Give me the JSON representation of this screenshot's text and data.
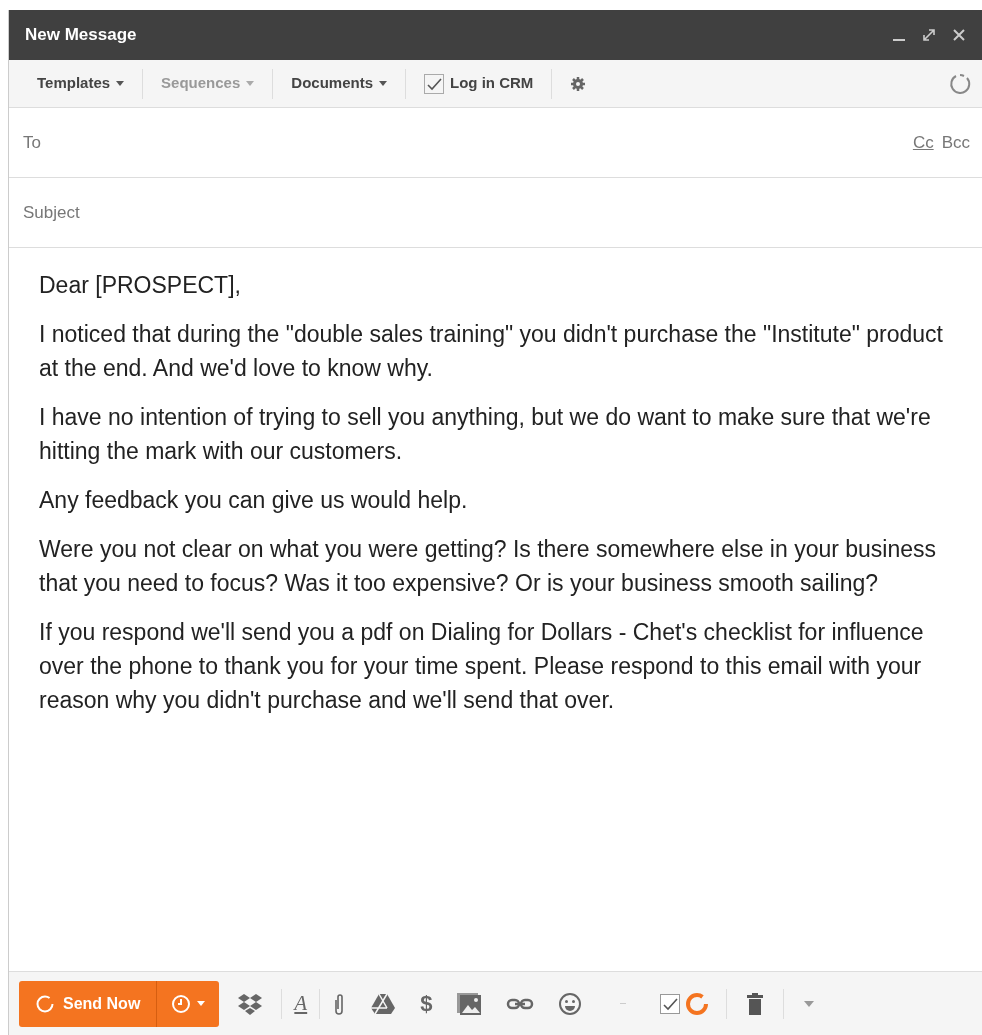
{
  "window": {
    "title": "New Message"
  },
  "toolbar": [
    {
      "kind": "dropdown",
      "label": "Templates",
      "disabled": false
    },
    {
      "kind": "dropdown",
      "label": "Sequences",
      "disabled": true
    },
    {
      "kind": "dropdown",
      "label": "Documents",
      "disabled": false
    },
    {
      "kind": "checkbox",
      "label": "Log in CRM",
      "checked": true
    },
    {
      "kind": "settings"
    }
  ],
  "to": {
    "placeholder": "To",
    "cc": "Cc",
    "bcc": "Bcc"
  },
  "subject": {
    "placeholder": "Subject"
  },
  "body": [
    "Dear [PROSPECT],",
    "I noticed that during the \"double sales training\" you didn't purchase the \"Institute\" product at the end. And we'd love to know why.",
    "I have no intention of trying to sell you anything, but we do want to make sure that we're hitting the mark with our customers.",
    "Any feedback you can give us would help.",
    "Were you not clear on what you were getting? Is there somewhere else in your business that you need to focus? Was it too expensive? Or is your business smooth sailing?",
    "If you respond we'll send you a pdf on Dialing for Dollars - Chet's checklist for influence over the phone to thank you for your time spent. Please respond to this email with your reason why you didn't purchase and we'll send that over."
  ],
  "footer": {
    "send_label": "Send Now",
    "format_glyph": "A",
    "dollar_glyph": "$",
    "track": {
      "checked": true
    }
  }
}
